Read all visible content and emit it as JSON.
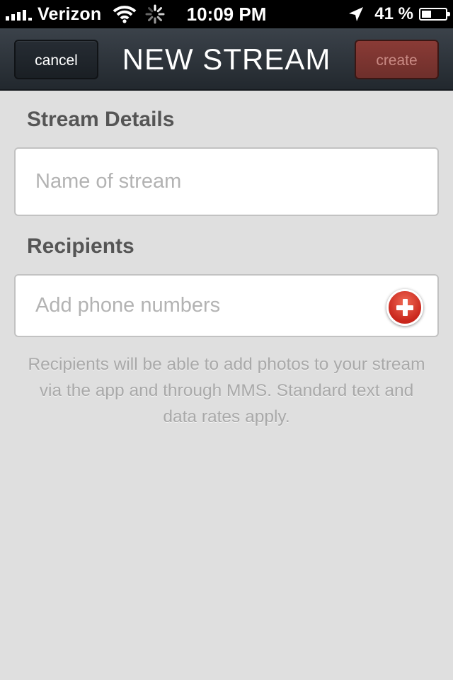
{
  "status_bar": {
    "carrier": "Verizon",
    "time": "10:09 PM",
    "battery_percent": "41 %",
    "battery_level": 0.41,
    "signal_icon": "cellular-signal-icon",
    "wifi_icon": "wifi-icon",
    "activity_icon": "activity-spinner-icon",
    "location_icon": "location-arrow-icon",
    "battery_icon": "battery-icon"
  },
  "navbar": {
    "title": "NEW STREAM",
    "cancel_label": "cancel",
    "create_label": "create"
  },
  "form": {
    "details_heading": "Stream Details",
    "name_placeholder": "Name of stream",
    "name_value": "",
    "recipients_heading": "Recipients",
    "phone_placeholder": "Add phone numbers",
    "phone_value": "",
    "add_icon": "add-plus-icon",
    "note": "Recipients will be able to add photos to your stream via the app and through MMS. Standard text and data rates apply."
  },
  "colors": {
    "navbar": "#2d343b",
    "create_button": "#7b342f",
    "background": "#dfdfdf",
    "add_button": "#d8392a"
  }
}
